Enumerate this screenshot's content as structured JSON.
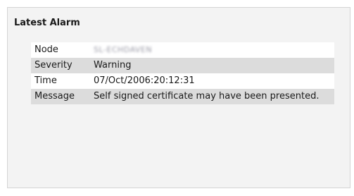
{
  "panel": {
    "title": "Latest Alarm"
  },
  "alarm": {
    "rows": [
      {
        "label": "Node",
        "value": "SL-ECHDAVEN",
        "redacted": true
      },
      {
        "label": "Severity",
        "value": "Warning"
      },
      {
        "label": "Time",
        "value": "07/Oct/2006:20:12:31"
      },
      {
        "label": "Message",
        "value": "Self signed certificate may have been presented."
      }
    ]
  }
}
